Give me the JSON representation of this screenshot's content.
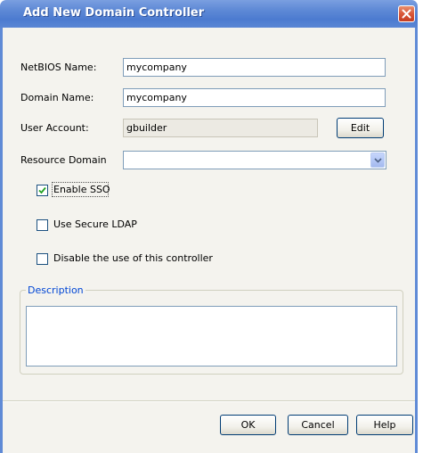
{
  "window": {
    "title": "Add New Domain Controller"
  },
  "form": {
    "netbios_label": "NetBIOS Name:",
    "netbios_value": "mycompany",
    "domain_label": "Domain Name:",
    "domain_value": "mycompany",
    "account_label": "User Account:",
    "account_value": "gbuilder",
    "edit_label": "Edit",
    "resource_label": "Resource Domain",
    "resource_value": ""
  },
  "options": {
    "sso_label": "Enable SSO",
    "sso_checked": true,
    "ldap_label": "Use Secure LDAP",
    "ldap_checked": false,
    "disable_label": "Disable the use of this controller",
    "disable_checked": false
  },
  "description": {
    "label": "Description",
    "value": ""
  },
  "footer": {
    "ok_label": "OK",
    "cancel_label": "Cancel",
    "help_label": "Help"
  },
  "colors": {
    "titlebar": "#5f8ad6",
    "dialog_bg": "#f4f3ee",
    "group_label": "#0046d5",
    "close": "#d9573a"
  },
  "icons": {
    "close": "close-icon",
    "dropdown": "chevron-down-icon",
    "check": "checkmark-icon"
  }
}
